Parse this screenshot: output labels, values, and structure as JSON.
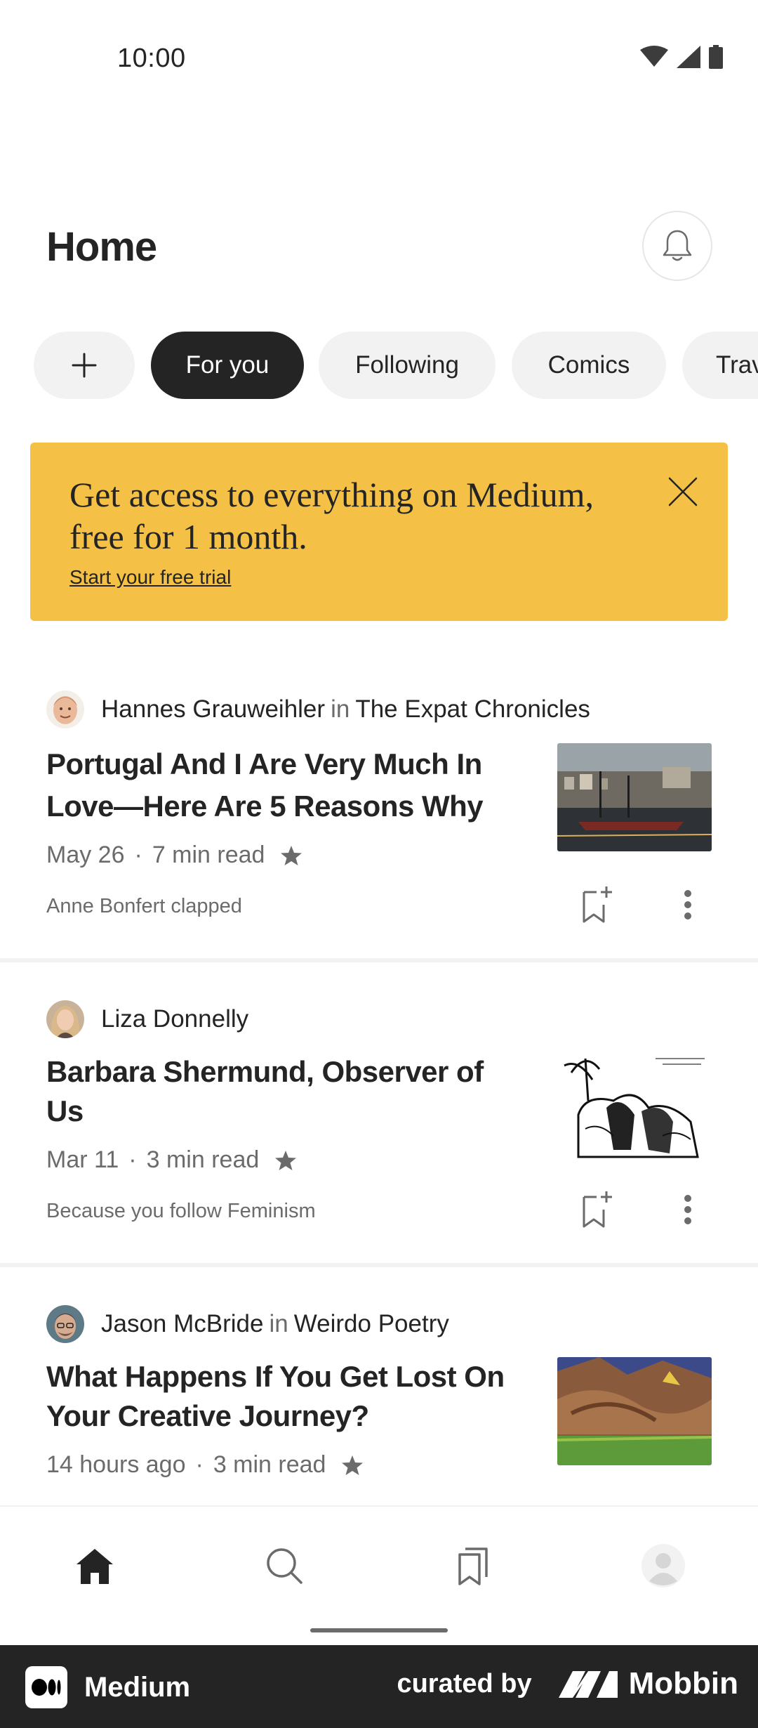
{
  "status_bar": {
    "time": "10:00"
  },
  "header": {
    "title": "Home"
  },
  "chips": [
    {
      "label": "+"
    },
    {
      "label": "For you",
      "active": true
    },
    {
      "label": "Following"
    },
    {
      "label": "Comics"
    },
    {
      "label": "Travel"
    }
  ],
  "banner": {
    "text": "Get access to everything on Medium, free for 1 month.",
    "link": "Start your free trial",
    "color": "#f4c045"
  },
  "articles": [
    {
      "author": "Hannes Grauweihler",
      "in": "in",
      "publication": "The Expat Chronicles",
      "title": "Portugal And I Are Very Much In Love—Here Are 5 Reasons Why",
      "date": "May 26",
      "read_time": "7 min read",
      "note": "Anne Bonfert clapped"
    },
    {
      "author": "Liza Donnelly",
      "title": "Barbara Shermund, Observer of Us",
      "date": "Mar 11",
      "read_time": "3 min read",
      "note": "Because you follow Feminism"
    },
    {
      "author": "Jason McBride",
      "in": "in",
      "publication": "Weirdo Poetry",
      "title": "What Happens If You Get Lost On Your Creative Journey?",
      "date": "14 hours ago",
      "read_time": "3 min read"
    }
  ],
  "meta_separator": "·",
  "bottom_nav": [
    "home-icon",
    "search-icon",
    "bookmarks-icon",
    "profile-icon"
  ],
  "footer": {
    "app_name": "Medium",
    "curated_by": "curated by",
    "brand": "Mobbin"
  },
  "colors": {
    "text": "#242424",
    "muted": "#6b6b6b",
    "chip": "#f2f2f2",
    "active_chip": "#242424"
  }
}
